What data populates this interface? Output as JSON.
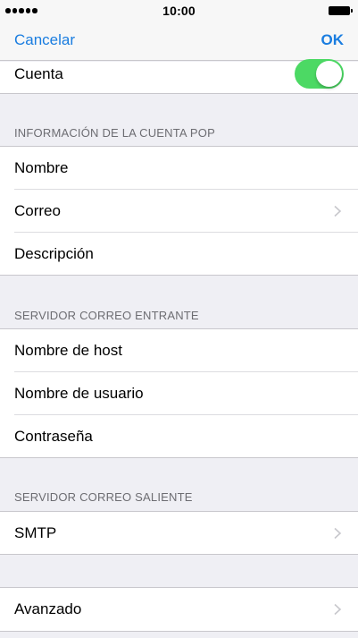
{
  "status_bar": {
    "time": "10:00",
    "signal_icon": "signal-dots-icon",
    "battery_icon": "battery-icon"
  },
  "nav": {
    "cancel_label": "Cancelar",
    "ok_label": "OK"
  },
  "account": {
    "label": "Cuenta",
    "toggle_on": true,
    "toggle_color": "#4cd964"
  },
  "pop_section": {
    "header": "INFORMACIÓN DE LA CUENTA POP",
    "rows": [
      {
        "label": "Nombre"
      },
      {
        "label": "Correo"
      },
      {
        "label": "Descripción"
      }
    ]
  },
  "incoming_section": {
    "header": "SERVIDOR CORREO ENTRANTE",
    "rows": [
      {
        "label": "Nombre de host"
      },
      {
        "label": "Nombre de usuario"
      },
      {
        "label": "Contraseña"
      }
    ]
  },
  "outgoing_section": {
    "header": "SERVIDOR CORREO SALIENTE",
    "rows": [
      {
        "label": "SMTP"
      }
    ]
  },
  "advanced": {
    "label": "Avanzado"
  },
  "colors": {
    "accent": "#1a7de0",
    "background": "#efeff4"
  }
}
